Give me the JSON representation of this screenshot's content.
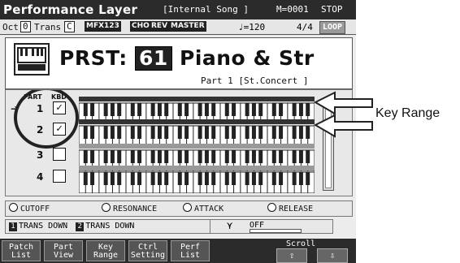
{
  "header": {
    "title": "Performance Layer",
    "song": "[Internal Song  ]",
    "measure": "M=0001",
    "status": "STOP"
  },
  "toolbar": {
    "oct_label": "Oct",
    "oct_value": "0",
    "trans_label": "Trans",
    "trans_value": "C",
    "fx": [
      "MFX123",
      "CHO",
      "REV",
      "MASTER"
    ],
    "tempo": "♩=120",
    "meter": "4/4",
    "loop": "LOOP"
  },
  "patch": {
    "prefix": "PRST:",
    "number": "61",
    "name": "Piano & Str",
    "part_info": "Part 1   [St.Concert  ]"
  },
  "parts_header": {
    "part": "PART",
    "kbd": "KBD"
  },
  "parts": [
    {
      "num": "1",
      "kbd": "✓",
      "selected": true
    },
    {
      "num": "2",
      "kbd": "✓",
      "selected": false
    },
    {
      "num": "3",
      "kbd": "",
      "selected": false
    },
    {
      "num": "4",
      "kbd": "",
      "selected": false
    }
  ],
  "knobs": [
    "CUTOFF",
    "RESONANCE",
    "ATTACK",
    "RELEASE"
  ],
  "trans": [
    "TRANS DOWN",
    "TRANS DOWN"
  ],
  "trans_nums": [
    "1",
    "2"
  ],
  "off_label": "OFF",
  "footer": {
    "buttons": [
      [
        "Patch",
        "List"
      ],
      [
        "Part",
        "View"
      ],
      [
        "Key",
        "Range"
      ],
      [
        "Ctrl",
        "Setting"
      ],
      [
        "Perf",
        "List"
      ]
    ],
    "scroll": "Scroll",
    "up": "⇧",
    "down": "⇩"
  },
  "annotation": "Key Range"
}
